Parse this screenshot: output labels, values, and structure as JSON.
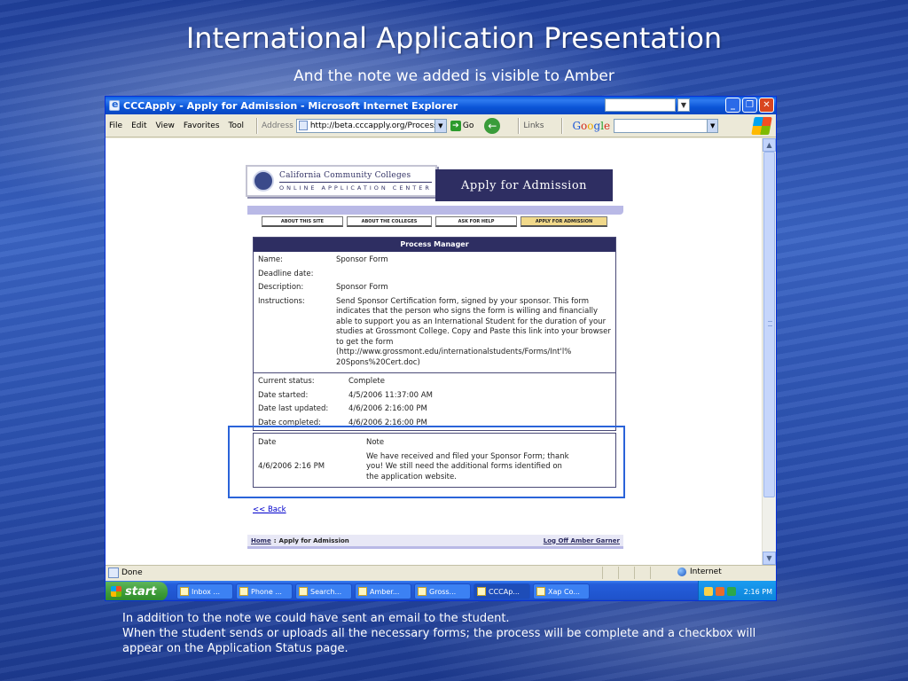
{
  "slide": {
    "title": "International Application Presentation",
    "subtitle": "And the note we added is visible to Amber",
    "notes": [
      "In addition to the note we could have sent an email to the student.",
      "When the student sends or uploads all the necessary forms; the process will be complete and a checkbox will appear on the Application Status page."
    ]
  },
  "browser": {
    "title": "CCCApply - Apply for Admission - Microsoft Internet Explorer",
    "menu": [
      "File",
      "Edit",
      "View",
      "Favorites",
      "Tool"
    ],
    "address_label": "Address",
    "address_url": "http://beta.cccapply.org/Process_Manag",
    "go_label": "Go",
    "links_label": "Links",
    "google_label": "Google",
    "status_text": "Done",
    "zone": "Internet",
    "window_buttons": [
      "minimize",
      "maximize",
      "close"
    ]
  },
  "site": {
    "college_name": "California Community Colleges",
    "center_name": "ONLINE APPLICATION CENTER",
    "banner": "Apply for Admission",
    "nav": [
      "ABOUT THIS SITE",
      "ABOUT THE COLLEGES",
      "ASK FOR HELP",
      "APPLY FOR ADMISSION"
    ],
    "process_manager": {
      "heading": "Process Manager",
      "name_label": "Name:",
      "name_value": "Sponsor Form",
      "deadline_label": "Deadline date:",
      "deadline_value": "",
      "description_label": "Description:",
      "description_value": "Sponsor Form",
      "instructions_label": "Instructions:",
      "instructions_value": "Send Sponsor Certification form, signed by your sponsor. This form indicates that the person who signs the form is willing and financially able to support you as an International Student for the duration of your studies at Grossmont College. Copy and Paste this link into your browser to get the form (http://www.grossmont.edu/internationalstudents/Forms/Int'l% 20Spons%20Cert.doc)",
      "status_label": "Current status:",
      "status_value": "Complete",
      "started_label": "Date started:",
      "started_value": "4/5/2006 11:37:00 AM",
      "updated_label": "Date last updated:",
      "updated_value": "4/6/2006 2:16:00 PM",
      "completed_label": "Date completed:",
      "completed_value": "4/6/2006 2:16:00 PM"
    },
    "notes_table": {
      "col_date": "Date",
      "col_note": "Note",
      "date_value": "4/6/2006 2:16 PM",
      "note_value": "We have received and filed your Sponsor Form; thank you! We still need the additional forms identified on the application website."
    },
    "back_link": "<< Back",
    "footer": {
      "home": "Home",
      "separator": ":",
      "current": "Apply for Admission",
      "logoff": "Log Off Amber Garner"
    }
  },
  "taskbar": {
    "start": "start",
    "tasks": [
      "Inbox ...",
      "Phone ...",
      "Search...",
      "Amber...",
      "Gross...",
      "CCCAp...",
      "Xap Co..."
    ],
    "clock": "2:16 PM"
  }
}
